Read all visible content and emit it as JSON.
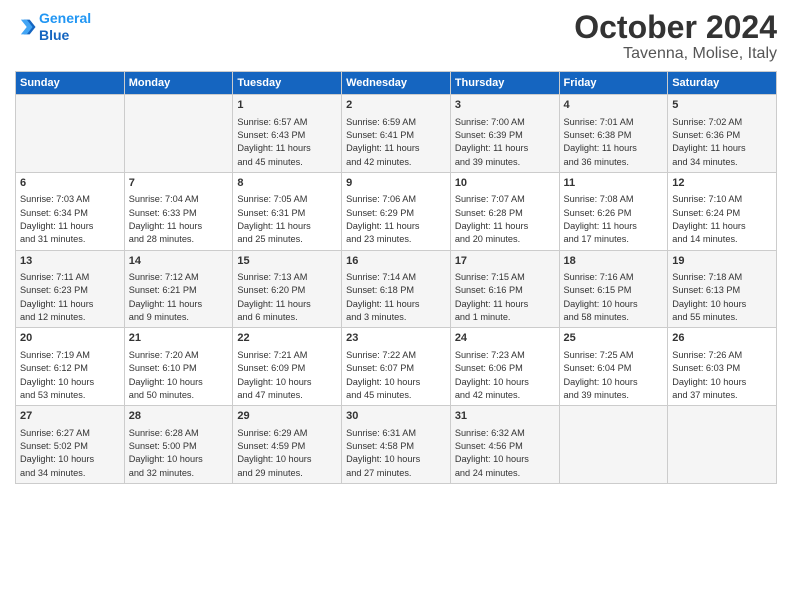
{
  "header": {
    "logo_line1": "General",
    "logo_line2": "Blue",
    "title": "October 2024",
    "subtitle": "Tavenna, Molise, Italy"
  },
  "days_of_week": [
    "Sunday",
    "Monday",
    "Tuesday",
    "Wednesday",
    "Thursday",
    "Friday",
    "Saturday"
  ],
  "weeks": [
    [
      {
        "day": "",
        "content": ""
      },
      {
        "day": "",
        "content": ""
      },
      {
        "day": "1",
        "content": "Sunrise: 6:57 AM\nSunset: 6:43 PM\nDaylight: 11 hours\nand 45 minutes."
      },
      {
        "day": "2",
        "content": "Sunrise: 6:59 AM\nSunset: 6:41 PM\nDaylight: 11 hours\nand 42 minutes."
      },
      {
        "day": "3",
        "content": "Sunrise: 7:00 AM\nSunset: 6:39 PM\nDaylight: 11 hours\nand 39 minutes."
      },
      {
        "day": "4",
        "content": "Sunrise: 7:01 AM\nSunset: 6:38 PM\nDaylight: 11 hours\nand 36 minutes."
      },
      {
        "day": "5",
        "content": "Sunrise: 7:02 AM\nSunset: 6:36 PM\nDaylight: 11 hours\nand 34 minutes."
      }
    ],
    [
      {
        "day": "6",
        "content": "Sunrise: 7:03 AM\nSunset: 6:34 PM\nDaylight: 11 hours\nand 31 minutes."
      },
      {
        "day": "7",
        "content": "Sunrise: 7:04 AM\nSunset: 6:33 PM\nDaylight: 11 hours\nand 28 minutes."
      },
      {
        "day": "8",
        "content": "Sunrise: 7:05 AM\nSunset: 6:31 PM\nDaylight: 11 hours\nand 25 minutes."
      },
      {
        "day": "9",
        "content": "Sunrise: 7:06 AM\nSunset: 6:29 PM\nDaylight: 11 hours\nand 23 minutes."
      },
      {
        "day": "10",
        "content": "Sunrise: 7:07 AM\nSunset: 6:28 PM\nDaylight: 11 hours\nand 20 minutes."
      },
      {
        "day": "11",
        "content": "Sunrise: 7:08 AM\nSunset: 6:26 PM\nDaylight: 11 hours\nand 17 minutes."
      },
      {
        "day": "12",
        "content": "Sunrise: 7:10 AM\nSunset: 6:24 PM\nDaylight: 11 hours\nand 14 minutes."
      }
    ],
    [
      {
        "day": "13",
        "content": "Sunrise: 7:11 AM\nSunset: 6:23 PM\nDaylight: 11 hours\nand 12 minutes."
      },
      {
        "day": "14",
        "content": "Sunrise: 7:12 AM\nSunset: 6:21 PM\nDaylight: 11 hours\nand 9 minutes."
      },
      {
        "day": "15",
        "content": "Sunrise: 7:13 AM\nSunset: 6:20 PM\nDaylight: 11 hours\nand 6 minutes."
      },
      {
        "day": "16",
        "content": "Sunrise: 7:14 AM\nSunset: 6:18 PM\nDaylight: 11 hours\nand 3 minutes."
      },
      {
        "day": "17",
        "content": "Sunrise: 7:15 AM\nSunset: 6:16 PM\nDaylight: 11 hours\nand 1 minute."
      },
      {
        "day": "18",
        "content": "Sunrise: 7:16 AM\nSunset: 6:15 PM\nDaylight: 10 hours\nand 58 minutes."
      },
      {
        "day": "19",
        "content": "Sunrise: 7:18 AM\nSunset: 6:13 PM\nDaylight: 10 hours\nand 55 minutes."
      }
    ],
    [
      {
        "day": "20",
        "content": "Sunrise: 7:19 AM\nSunset: 6:12 PM\nDaylight: 10 hours\nand 53 minutes."
      },
      {
        "day": "21",
        "content": "Sunrise: 7:20 AM\nSunset: 6:10 PM\nDaylight: 10 hours\nand 50 minutes."
      },
      {
        "day": "22",
        "content": "Sunrise: 7:21 AM\nSunset: 6:09 PM\nDaylight: 10 hours\nand 47 minutes."
      },
      {
        "day": "23",
        "content": "Sunrise: 7:22 AM\nSunset: 6:07 PM\nDaylight: 10 hours\nand 45 minutes."
      },
      {
        "day": "24",
        "content": "Sunrise: 7:23 AM\nSunset: 6:06 PM\nDaylight: 10 hours\nand 42 minutes."
      },
      {
        "day": "25",
        "content": "Sunrise: 7:25 AM\nSunset: 6:04 PM\nDaylight: 10 hours\nand 39 minutes."
      },
      {
        "day": "26",
        "content": "Sunrise: 7:26 AM\nSunset: 6:03 PM\nDaylight: 10 hours\nand 37 minutes."
      }
    ],
    [
      {
        "day": "27",
        "content": "Sunrise: 6:27 AM\nSunset: 5:02 PM\nDaylight: 10 hours\nand 34 minutes."
      },
      {
        "day": "28",
        "content": "Sunrise: 6:28 AM\nSunset: 5:00 PM\nDaylight: 10 hours\nand 32 minutes."
      },
      {
        "day": "29",
        "content": "Sunrise: 6:29 AM\nSunset: 4:59 PM\nDaylight: 10 hours\nand 29 minutes."
      },
      {
        "day": "30",
        "content": "Sunrise: 6:31 AM\nSunset: 4:58 PM\nDaylight: 10 hours\nand 27 minutes."
      },
      {
        "day": "31",
        "content": "Sunrise: 6:32 AM\nSunset: 4:56 PM\nDaylight: 10 hours\nand 24 minutes."
      },
      {
        "day": "",
        "content": ""
      },
      {
        "day": "",
        "content": ""
      }
    ]
  ]
}
